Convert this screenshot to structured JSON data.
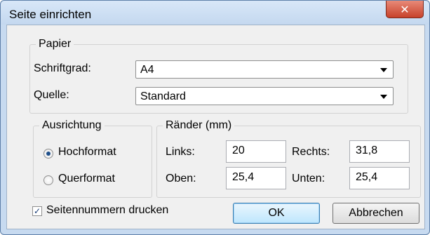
{
  "window": {
    "title": "Seite einrichten",
    "close_glyph": "✕"
  },
  "paper": {
    "legend": "Papier",
    "size_label": "Schriftgrad:",
    "size_value": "A4",
    "source_label": "Quelle:",
    "source_value": "Standard"
  },
  "orientation": {
    "legend": "Ausrichtung",
    "portrait_label": "Hochformat",
    "landscape_label": "Querformat",
    "selected": "Hochformat"
  },
  "margins": {
    "legend": "Ränder (mm)",
    "left_label": "Links:",
    "left_value": "20",
    "right_label": "Rechts:",
    "right_value": "31,8",
    "top_label": "Oben:",
    "top_value": "25,4",
    "bottom_label": "Unten:",
    "bottom_value": "25,4"
  },
  "print_page_numbers": {
    "label": "Seitennummern drucken",
    "checked": true,
    "check_glyph": "✓"
  },
  "buttons": {
    "ok": "OK",
    "cancel": "Abbrechen"
  }
}
